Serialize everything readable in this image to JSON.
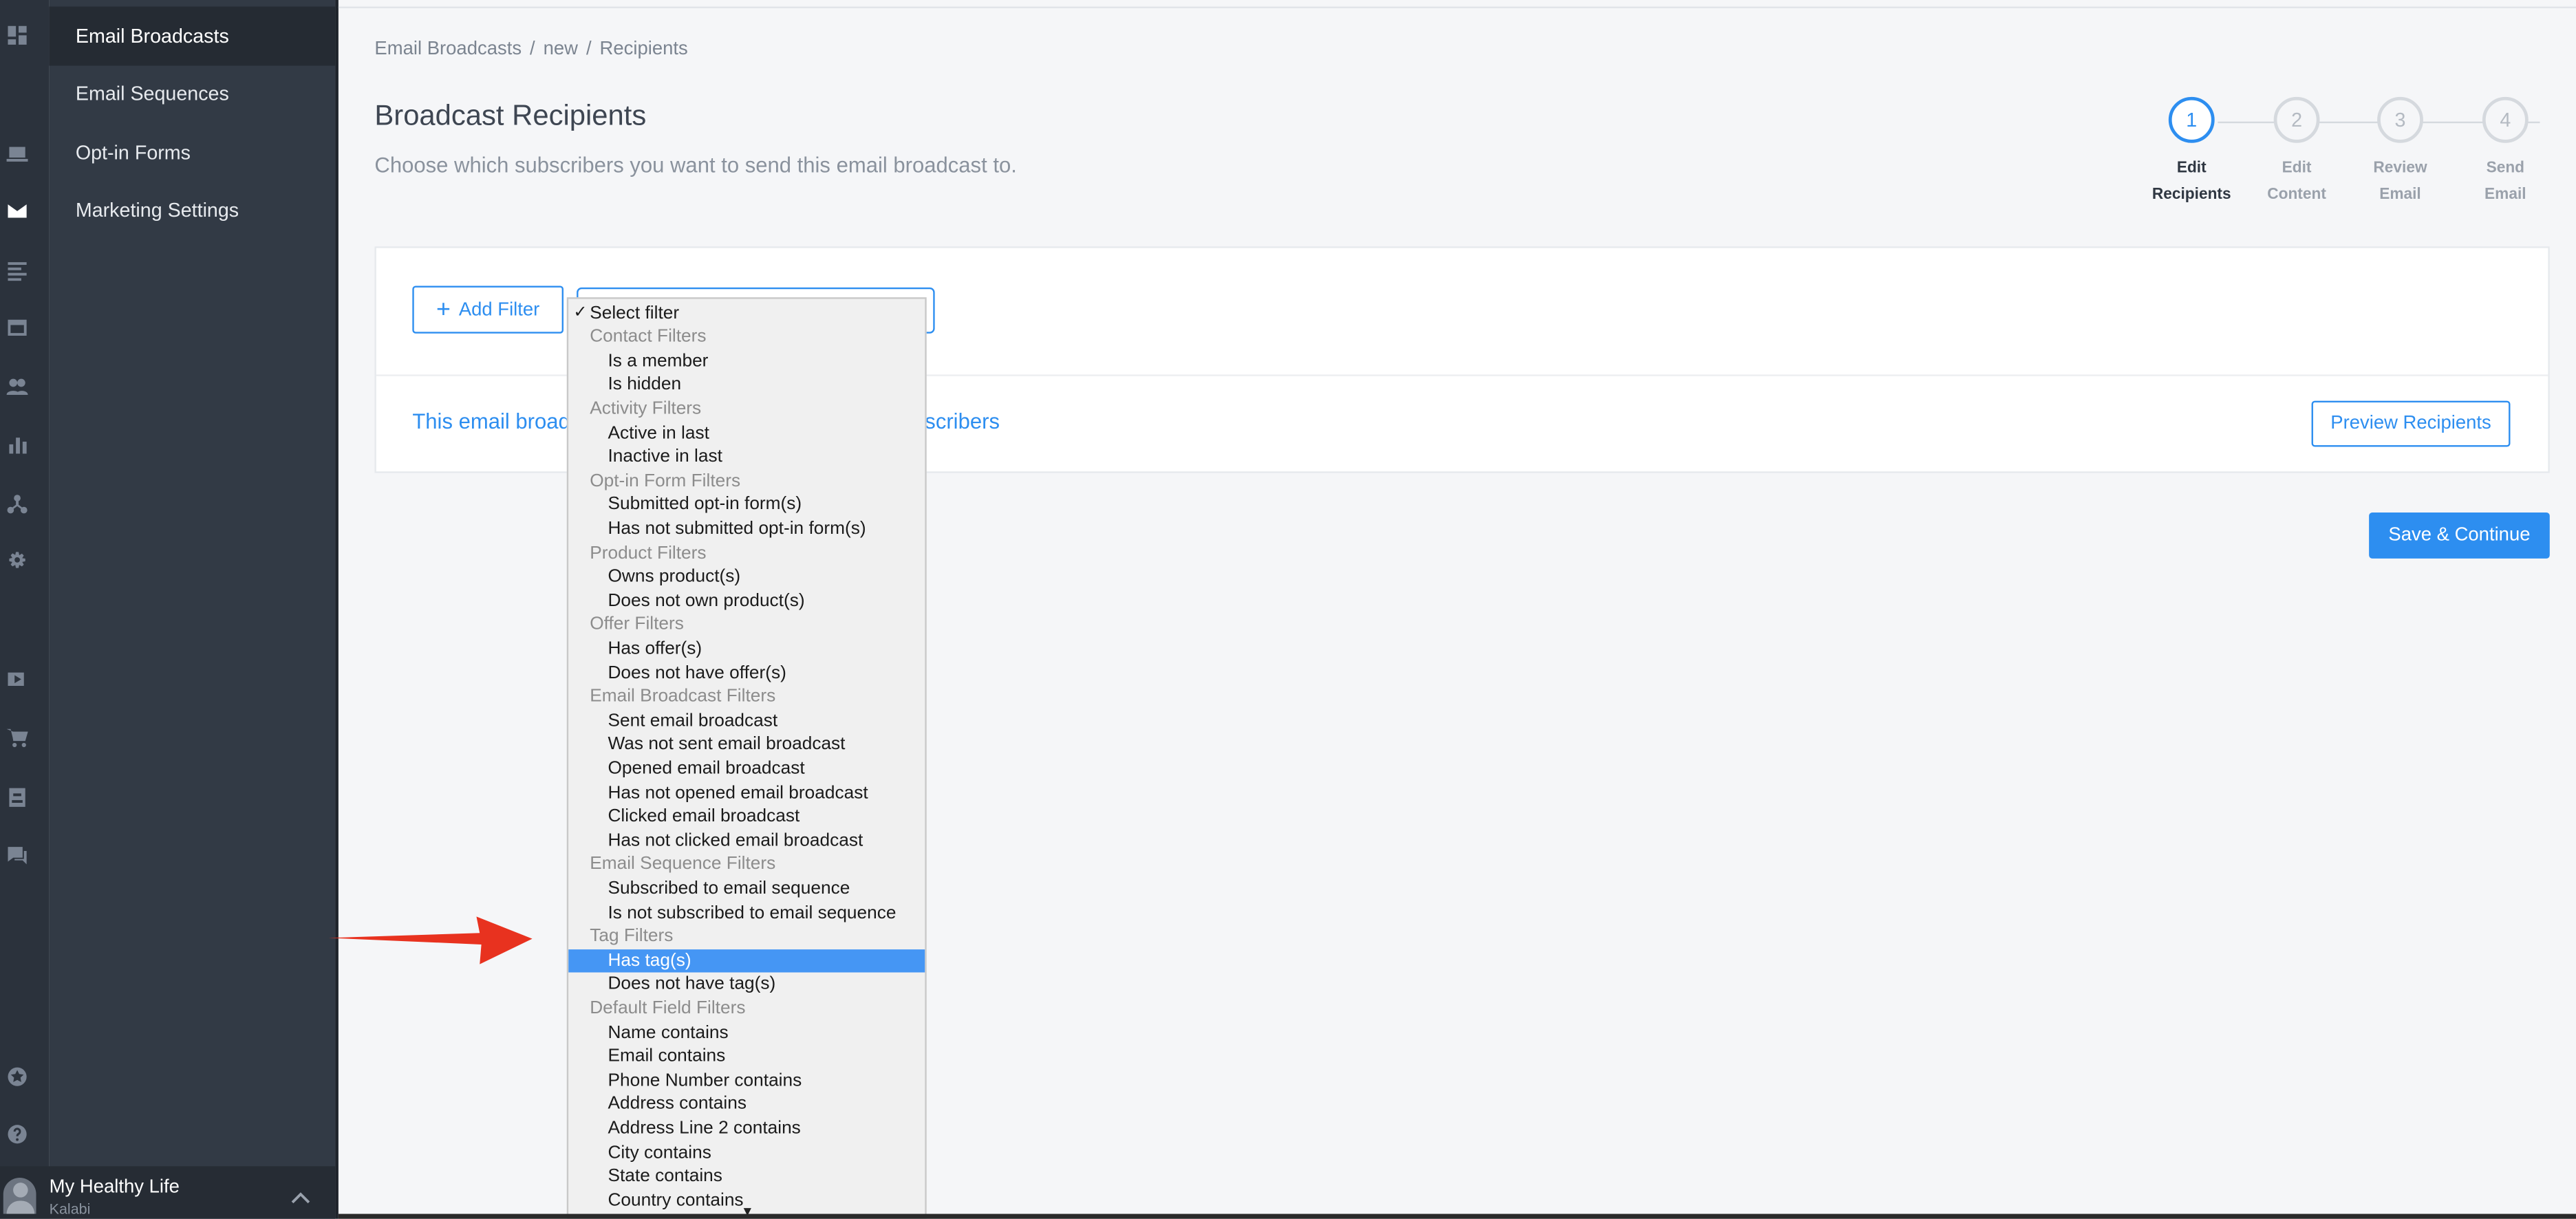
{
  "sidebar": {
    "rail_icons": [
      "dashboard-icon",
      "laptop-icon",
      "mail-icon",
      "list-icon",
      "layout-icon",
      "users-icon",
      "bar-chart-icon",
      "network-icon",
      "gear-icon",
      "video-icon",
      "cart-icon",
      "contact-card-icon",
      "chat-icon",
      "star-icon",
      "help-icon"
    ],
    "menu": [
      "Email Broadcasts",
      "Email Sequences",
      "Opt-in Forms",
      "Marketing Settings"
    ],
    "account": {
      "name": "My Healthy Life",
      "sub": "Kalabi"
    }
  },
  "breadcrumb": [
    "Email Broadcasts",
    "/",
    "new",
    "/",
    "Recipients"
  ],
  "page": {
    "title": "Broadcast Recipients",
    "subtitle": "Choose which subscribers you want to send this email broadcast to."
  },
  "steps": [
    {
      "num": "1",
      "line1": "Edit",
      "line2": "Recipients",
      "active": true
    },
    {
      "num": "2",
      "line1": "Edit",
      "line2": "Content",
      "active": false
    },
    {
      "num": "3",
      "line1": "Review",
      "line2": "Email",
      "active": false
    },
    {
      "num": "4",
      "line1": "Send",
      "line2": "Email",
      "active": false
    }
  ],
  "filters": {
    "add_filter_label": "Add Filter",
    "add_icon": "+",
    "info_start": "This email broad",
    "info_end": "scribers",
    "preview_label": "Preview Recipients"
  },
  "save_label": "Save & Continue",
  "dropdown": {
    "check": "✓",
    "header": "Select filter",
    "groups": [
      {
        "label": "Contact Filters",
        "options": [
          "Is a member",
          "Is hidden"
        ]
      },
      {
        "label": "Activity Filters",
        "options": [
          "Active in last",
          "Inactive in last"
        ]
      },
      {
        "label": "Opt-in Form Filters",
        "options": [
          "Submitted opt-in form(s)",
          "Has not submitted opt-in form(s)"
        ]
      },
      {
        "label": "Product Filters",
        "options": [
          "Owns product(s)",
          "Does not own product(s)"
        ]
      },
      {
        "label": "Offer Filters",
        "options": [
          "Has offer(s)",
          "Does not have offer(s)"
        ]
      },
      {
        "label": "Email Broadcast Filters",
        "options": [
          "Sent email broadcast",
          "Was not sent email broadcast",
          "Opened email broadcast",
          "Has not opened email broadcast",
          "Clicked email broadcast",
          "Has not clicked email broadcast"
        ]
      },
      {
        "label": "Email Sequence Filters",
        "options": [
          "Subscribed to email sequence",
          "Is not subscribed to email sequence"
        ]
      },
      {
        "label": "Tag Filters",
        "options": [
          "Has tag(s)",
          "Does not have tag(s)"
        ]
      },
      {
        "label": "Default Field Filters",
        "options": [
          "Name contains",
          "Email contains",
          "Phone Number contains",
          "Address contains",
          "Address Line 2 contains",
          "City contains",
          "State contains",
          "Country contains"
        ]
      }
    ],
    "highlighted": "Has tag(s)",
    "scroll_glyph": "▼"
  },
  "colors": {
    "accent": "#2d8ef0",
    "highlight": "#4596f4",
    "arrow": "#e8321f",
    "sidebar": "#323a45"
  }
}
